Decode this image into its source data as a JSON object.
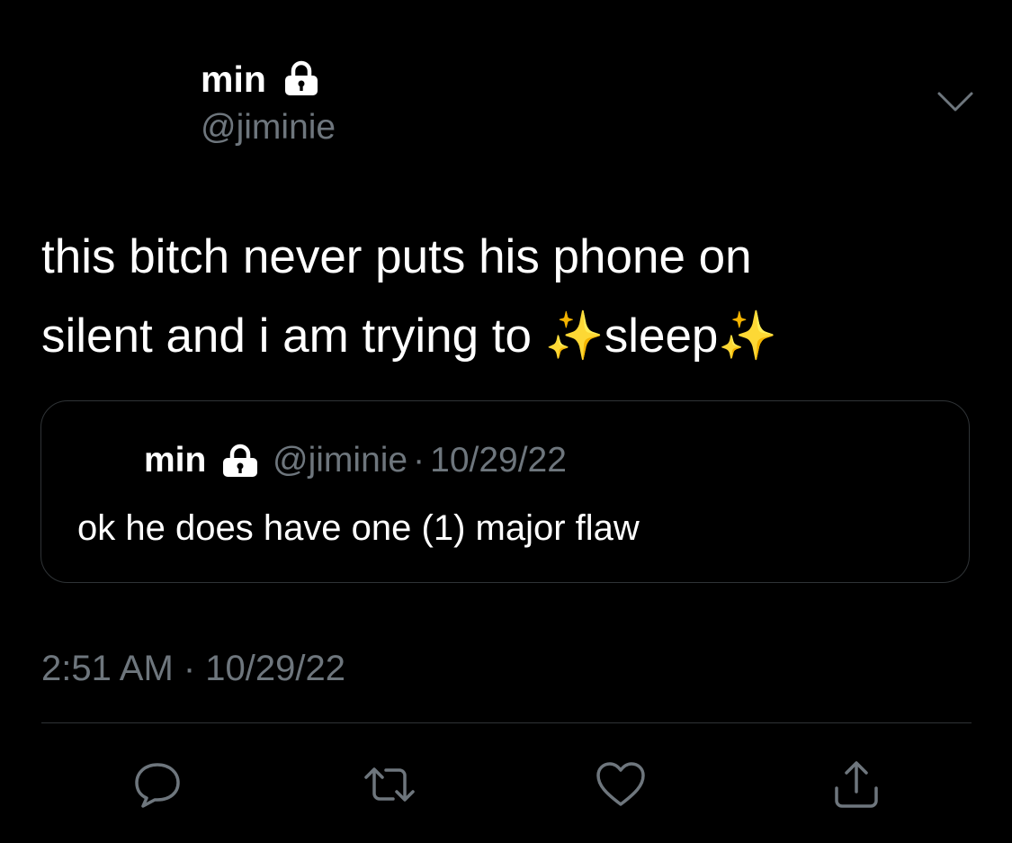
{
  "header": {
    "display_name": "min",
    "handle": "@jiminie",
    "lock_icon": "lock-icon",
    "more_icon": "chevron-down-icon"
  },
  "tweet": {
    "text": "this bitch never puts his phone on\nsilent and i am trying to ✨sleep✨",
    "timestamp": "2:51 AM · 10/29/22"
  },
  "quote": {
    "display_name": "min",
    "handle": "@jiminie",
    "date": "10/29/22",
    "separator": "·",
    "text": "ok he does have one (1) major flaw"
  },
  "actions": {
    "reply_icon": "comment-icon",
    "retweet_icon": "retweet-icon",
    "like_icon": "heart-icon",
    "share_icon": "share-icon"
  },
  "colors": {
    "background": "#000000",
    "primary_text": "#ffffff",
    "secondary_text": "#6e767d",
    "border": "#2f3336",
    "icon": "#6e767d"
  }
}
